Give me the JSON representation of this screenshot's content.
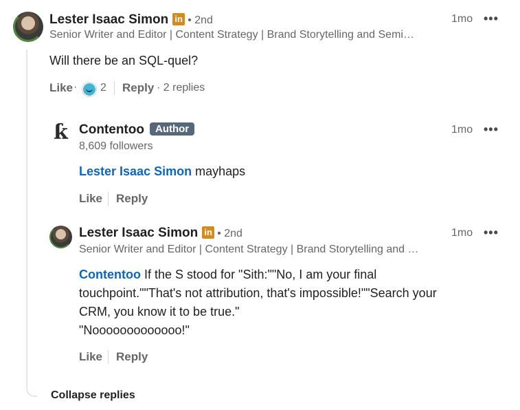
{
  "comment": {
    "author": "Lester Isaac Simon",
    "linkedin_badge": "in",
    "degree": "• 2nd",
    "headline": "Senior Writer and Editor | Content Strategy | Brand Storytelling and Semi…",
    "time": "1mo",
    "more": "•••",
    "text": "Will there be an SQL-quel?",
    "like_label": "Like",
    "like_sep": "·",
    "reaction_count": "2",
    "reply_label": "Reply",
    "replies_info": "· 2 replies"
  },
  "reply1": {
    "author": "Contentoo",
    "author_badge": "Author",
    "followers": "8,609 followers",
    "time": "1mo",
    "more": "•••",
    "mention": "Lester Isaac Simon",
    "text": " mayhaps",
    "like_label": "Like",
    "reply_label": "Reply"
  },
  "reply2": {
    "author": "Lester Isaac Simon",
    "linkedin_badge": "in",
    "degree": "• 2nd",
    "headline": "Senior Writer and Editor | Content Strategy | Brand Storytelling and …",
    "time": "1mo",
    "more": "•••",
    "mention": "Contentoo",
    "text_line1": " If the S stood for \"Sith:\"\"No, I am your final",
    "text_line2": "touchpoint.\"\"That's not attribution, that's impossible!\"\"Search your",
    "text_line3": "CRM, you know it to be true.\"",
    "text_line4": "\"Nooooooooooooo!\"",
    "like_label": "Like",
    "reply_label": "Reply"
  },
  "collapse_label": "Collapse replies",
  "colors": {
    "mention": "#0a66c2",
    "author_badge": "#56687a",
    "linkedin_badge": "#d58b1c",
    "reaction": "#44b4d4"
  },
  "icons": {
    "linkedin": "linkedin-icon",
    "reaction": "funny-reaction-icon",
    "more": "more-options-icon",
    "logo": "contentoo-logo"
  }
}
